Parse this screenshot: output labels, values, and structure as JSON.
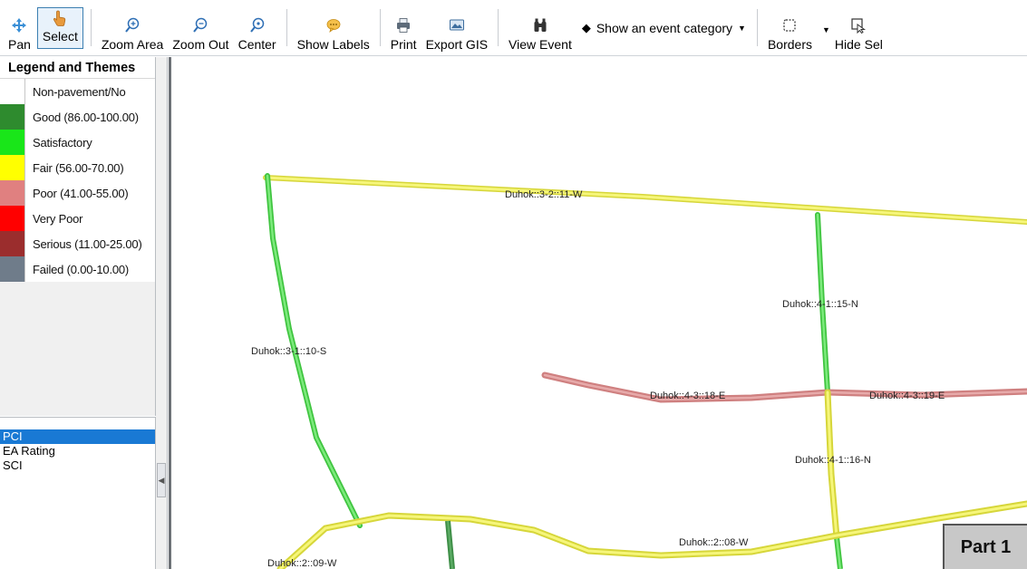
{
  "toolbar": {
    "pan": "Pan",
    "select": "Select",
    "zoom_area": "Zoom Area",
    "zoom_out": "Zoom Out",
    "center": "Center",
    "show_labels": "Show Labels",
    "print": "Print",
    "export_gis": "Export GIS",
    "view_event": "View Event",
    "event_category": "Show an event category",
    "borders": "Borders",
    "hide_sel": "Hide Sel"
  },
  "legend": {
    "title": "Legend and Themes",
    "items": [
      {
        "label": "Non-pavement/No",
        "color": "#ffffff"
      },
      {
        "label": "Good (86.00-100.00)",
        "color": "#2e8b2e"
      },
      {
        "label": "Satisfactory",
        "color": "#19e619"
      },
      {
        "label": "Fair (56.00-70.00)",
        "color": "#ffff00"
      },
      {
        "label": "Poor (41.00-55.00)",
        "color": "#e08080"
      },
      {
        "label": "Very Poor",
        "color": "#ff0000"
      },
      {
        "label": "Serious (11.00-25.00)",
        "color": "#9b2d2d"
      },
      {
        "label": "Failed (0.00-10.00)",
        "color": "#6f7c8a"
      }
    ]
  },
  "themes": [
    {
      "label": "PCI",
      "active": true
    },
    {
      "label": "EA Rating",
      "active": false
    },
    {
      "label": "SCI",
      "active": false
    }
  ],
  "map": {
    "labels": {
      "seg_11w": "Duhok::3-2::11-W",
      "seg_10s": "Duhok::3-1::10-S",
      "seg_15n": "Duhok::4-1::15-N",
      "seg_18e": "Duhok::4-3::18-E",
      "seg_19e": "Duhok::4-3::19-E",
      "seg_16n": "Duhok::4-1::16-N",
      "seg_08w": "Duhok::2::08-W",
      "seg_09w": "Duhok::2::09-W"
    }
  },
  "badge": "Part 1",
  "colors": {
    "fair": "#f2f25a",
    "satisfactory": "#4cd94c",
    "good": "#3f8f48",
    "poor": "#d98d8d",
    "selection": "#1979d4"
  }
}
